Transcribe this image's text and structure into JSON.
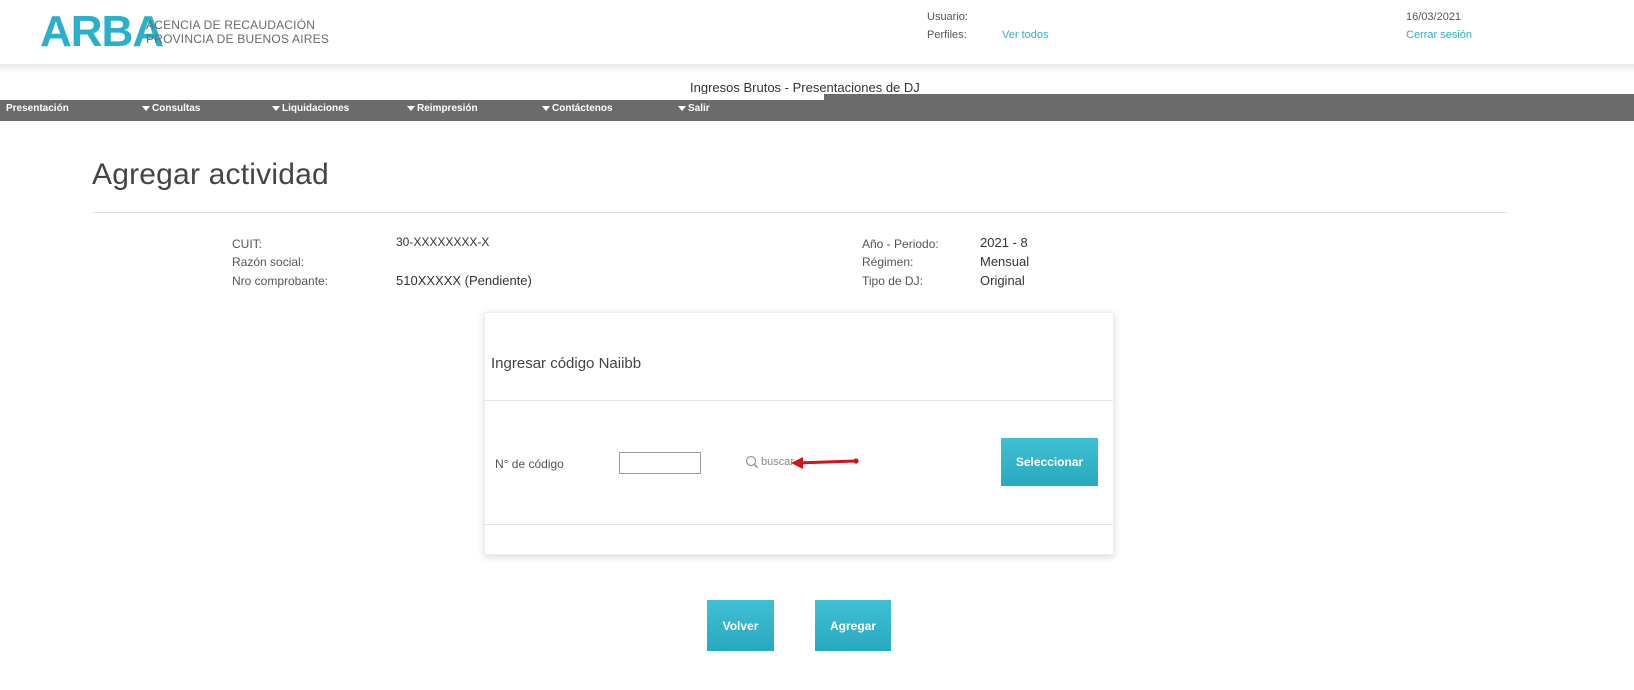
{
  "header": {
    "logo_word": "ARBA",
    "logo_line1": "ACENCIA DE RECAUDACIÓN",
    "logo_line2": "PROVINCIA DE BUENOS AIRES",
    "usuario_label": "Usuario:",
    "perfiles_label": "Perfiles:",
    "ver_todos": "Ver todos",
    "date": "16/03/2021",
    "cerrar_sesion": "Cerrar sesión"
  },
  "system_title": "Ingresos Brutos - Presentaciones de DJ",
  "menu": {
    "items": [
      {
        "label": "Presentación"
      },
      {
        "label": "Consultas"
      },
      {
        "label": "Liquidaciones"
      },
      {
        "label": "Reimpresión"
      },
      {
        "label": "Contáctenos"
      },
      {
        "label": "Salir"
      }
    ]
  },
  "page_title": "Agregar actividad",
  "info": {
    "cuit_label": "CUIT:",
    "cuit_value": "30-XXXXXXXX-X",
    "razon_label": "Razón social:",
    "nro_label": "Nro comprobante:",
    "nro_value": "510XXXXX (Pendiente)",
    "anio_label": "Año - Periodo:",
    "anio_value": "2021 - 8",
    "regimen_label": "Régimen:",
    "regimen_value": "Mensual",
    "tipo_label": "Tipo de DJ:",
    "tipo_value": "Original"
  },
  "card": {
    "title": "Ingresar código Naiibb",
    "code_label": "N° de código",
    "code_value": "",
    "buscar": "buscar",
    "seleccionar": "Seleccionar"
  },
  "actions": {
    "volver": "Volver",
    "agregar": "Agregar"
  },
  "colors": {
    "brand": "#2bb0c9",
    "menu_bg": "#6b6b6b",
    "arrow": "#d0161b"
  }
}
